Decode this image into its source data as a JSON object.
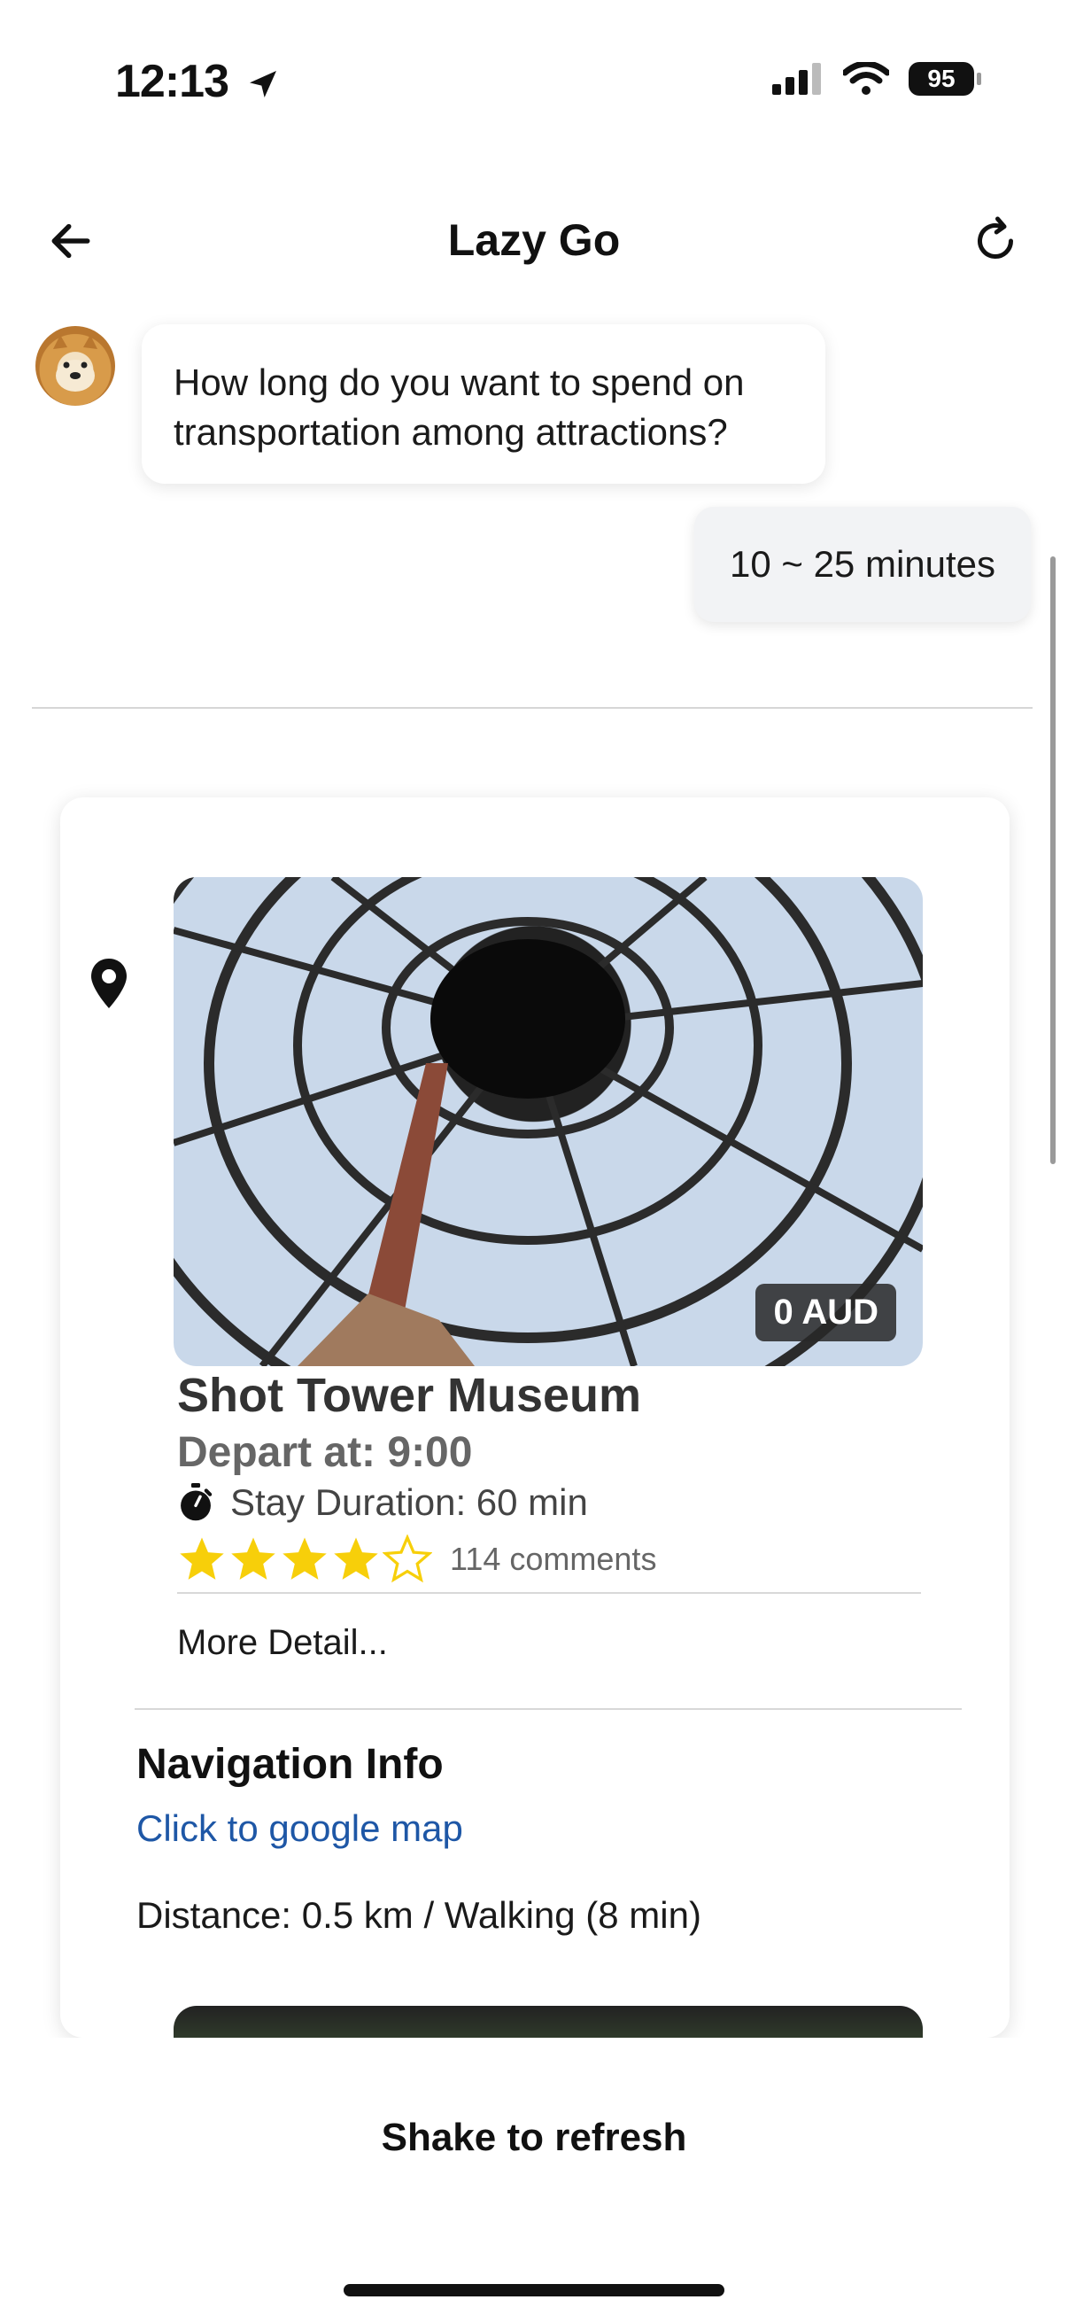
{
  "status_bar": {
    "time": "12:13",
    "battery": "95"
  },
  "header": {
    "title": "Lazy Go"
  },
  "chat": {
    "bot_message": "How long do you want to spend on transportation among attractions?",
    "user_message": "10 ~ 25 minutes"
  },
  "attraction": {
    "name": "Shot Tower Museum",
    "price": "0 AUD",
    "depart": "Depart at: 9:00",
    "stay_duration": "Stay Duration: 60 min",
    "rating": 4,
    "rating_max": 5,
    "comments": "114 comments",
    "more_detail": "More Detail..."
  },
  "navigation": {
    "title": "Navigation Info",
    "link_text": "Click to google map",
    "distance": "Distance: 0.5 km / Walking (8 min)"
  },
  "footer": {
    "shake_text": "Shake to refresh"
  },
  "colors": {
    "star": "#f7cf0a",
    "link": "#1e57a6"
  }
}
